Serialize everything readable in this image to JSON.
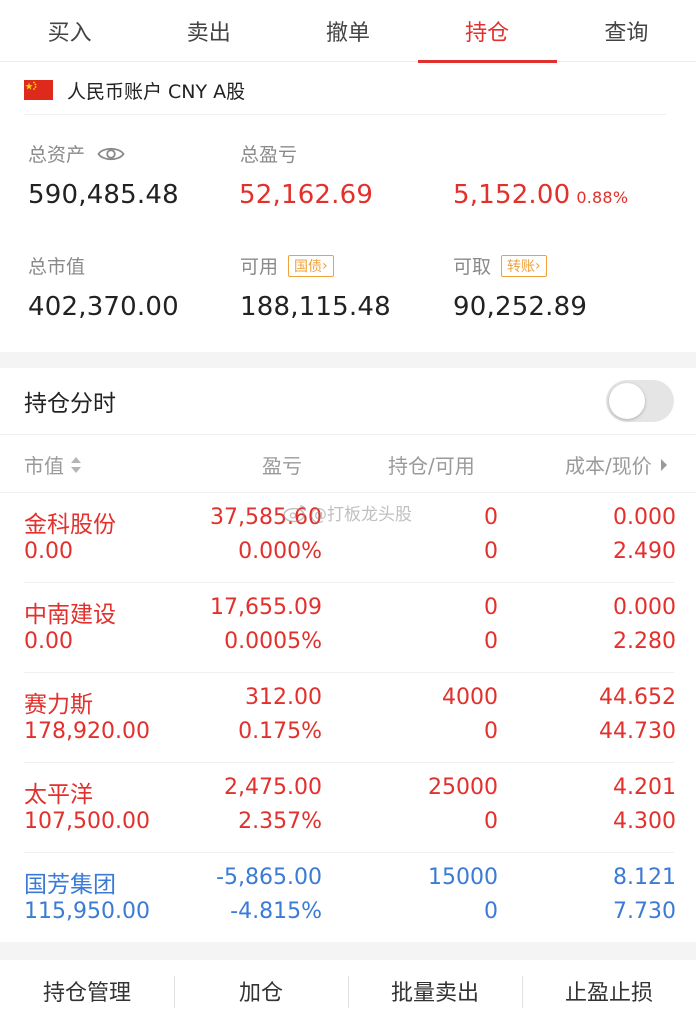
{
  "tabs": [
    {
      "label": "买入"
    },
    {
      "label": "卖出"
    },
    {
      "label": "撤单"
    },
    {
      "label": "持仓"
    },
    {
      "label": "查询"
    }
  ],
  "active_tab": "持仓",
  "account": {
    "label": "人民币账户 CNY A股"
  },
  "summary": {
    "total_assets_label": "总资产",
    "total_assets": "590,485.48",
    "total_pl_label": "总盈亏",
    "total_pl": "52,162.69",
    "today_pl": "5,152.00",
    "today_pl_pct": "0.88%",
    "market_value_label": "总市值",
    "market_value": "402,370.00",
    "available_label": "可用",
    "available_tag": "国债",
    "available": "188,115.48",
    "withdrawable_label": "可取",
    "withdrawable_tag": "转账",
    "withdrawable": "90,252.89"
  },
  "holdings": {
    "title": "持仓分时",
    "toggle_on": false,
    "columns": {
      "market_value": "市值",
      "pl": "盈亏",
      "qty": "持仓/可用",
      "cost_price": "成本/现价"
    },
    "rows": [
      {
        "name": "金科股份",
        "market_value": "0.00",
        "pl": "37,585.60",
        "pl_pct": "0.000%",
        "qty": "0",
        "available": "0",
        "cost": "0.000",
        "price": "2.490",
        "color": "#e2302c"
      },
      {
        "name": "中南建设",
        "market_value": "0.00",
        "pl": "17,655.09",
        "pl_pct": "0.0005%",
        "qty": "0",
        "available": "0",
        "cost": "0.000",
        "price": "2.280",
        "color": "#e2302c"
      },
      {
        "name": "赛力斯",
        "market_value": "178,920.00",
        "pl": "312.00",
        "pl_pct": "0.175%",
        "qty": "4000",
        "available": "0",
        "cost": "44.652",
        "price": "44.730",
        "color": "#e2302c"
      },
      {
        "name": "太平洋",
        "market_value": "107,500.00",
        "pl": "2,475.00",
        "pl_pct": "2.357%",
        "qty": "25000",
        "available": "0",
        "cost": "4.201",
        "price": "4.300",
        "color": "#e2302c"
      },
      {
        "name": "国芳集团",
        "market_value": "115,950.00",
        "pl": "-5,865.00",
        "pl_pct": "-4.815%",
        "qty": "15000",
        "available": "0",
        "cost": "8.121",
        "price": "7.730",
        "color": "#3b7bd6"
      }
    ]
  },
  "watermark": "@打板龙头股",
  "bottom_actions": [
    {
      "label": "持仓管理"
    },
    {
      "label": "加仓"
    },
    {
      "label": "批量卖出"
    },
    {
      "label": "止盈止损"
    }
  ],
  "colors": {
    "accent": "#e2302c",
    "loss": "#3b7bd6",
    "tag": "#f0a23a"
  }
}
